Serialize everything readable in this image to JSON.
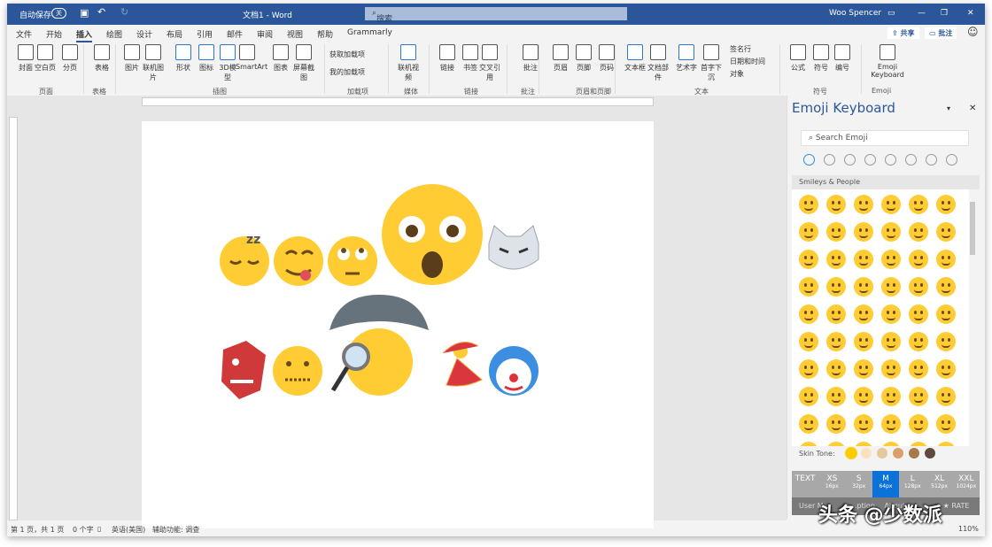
{
  "titlebar": {
    "autosave": "自动保存",
    "autosave_state": "关",
    "doc_title": "文档1 - Word",
    "search_placeholder": "搜索",
    "user": "Woo Spencer"
  },
  "tabs": [
    "文件",
    "开始",
    "插入",
    "绘图",
    "设计",
    "布局",
    "引用",
    "邮件",
    "审阅",
    "视图",
    "帮助",
    "Grammarly"
  ],
  "active_tab": "插入",
  "share": "共享",
  "comments": "批注",
  "ribbon": {
    "buttons": [
      "封面",
      "空白页",
      "分页",
      "表格",
      "图片",
      "联机图片",
      "形状",
      "图标",
      "3D模型",
      "SmartArt",
      "图表",
      "屏幕截图",
      "联机视频",
      "链接",
      "书签",
      "交叉引用",
      "批注",
      "页眉",
      "页脚",
      "页码",
      "文本框",
      "文档部件",
      "艺术字",
      "首字下沉",
      "公式",
      "符号",
      "编号",
      "Emoji Keyboard"
    ],
    "small": [
      "获取加载项",
      "我的加载项",
      "签名行",
      "日期和时间",
      "对象"
    ],
    "groups": [
      "页面",
      "表格",
      "插图",
      "加载项",
      "媒体",
      "链接",
      "批注",
      "页眉和页脚",
      "文本",
      "符号",
      "Emoji"
    ]
  },
  "panel": {
    "title": "Emoji Keyboard",
    "search_placeholder": "Search Emoji",
    "section": "Smileys & People",
    "skin_tone_label": "Skin Tone:",
    "skin_tones": [
      "#ffcc00",
      "#fbe0c0",
      "#e4c99a",
      "#d9a06a",
      "#a8784a",
      "#5e4a3e"
    ],
    "sizes": [
      {
        "label": "TEXT",
        "px": ""
      },
      {
        "label": "XS",
        "px": "16px"
      },
      {
        "label": "S",
        "px": "32px"
      },
      {
        "label": "M",
        "px": "64px"
      },
      {
        "label": "L",
        "px": "128px"
      },
      {
        "label": "XL",
        "px": "512px"
      },
      {
        "label": "XXL",
        "px": "1024px"
      }
    ],
    "selected_size": "M",
    "footer": [
      "User M...",
      "...ption",
      "About",
      "★ RATE"
    ]
  },
  "status": {
    "page": "第 1 页，共 1 页",
    "words": "0 个字",
    "lang": "英语(美国)",
    "access": "辅助功能: 调查",
    "zoom": "110%"
  },
  "watermark": "头条 @少数派"
}
